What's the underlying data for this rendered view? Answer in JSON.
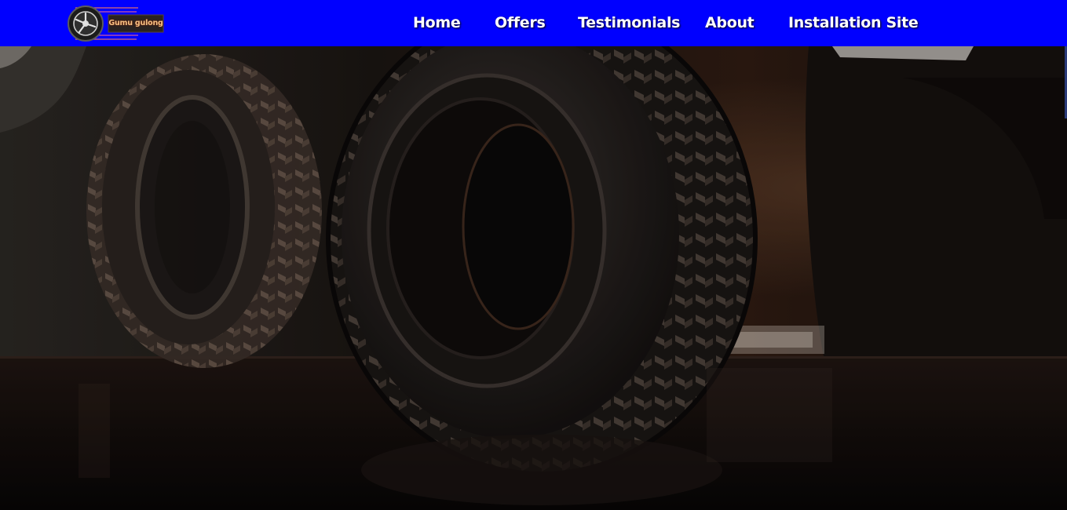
{
  "header": {
    "logo_text": "Gumu gulong",
    "background_color": "#0000ff"
  },
  "nav": {
    "items": [
      {
        "label": "Home"
      },
      {
        "label": "Offers"
      },
      {
        "label": "Testimonials"
      },
      {
        "label": "About"
      },
      {
        "label": "Installation Site"
      }
    ]
  },
  "hero": {
    "image_subject": "tire-photo",
    "tone_colors": [
      "#2b1a12",
      "#0c0806",
      "#6b4a35"
    ]
  },
  "icons": {
    "logo_mark": "tire-wheel-icon"
  }
}
